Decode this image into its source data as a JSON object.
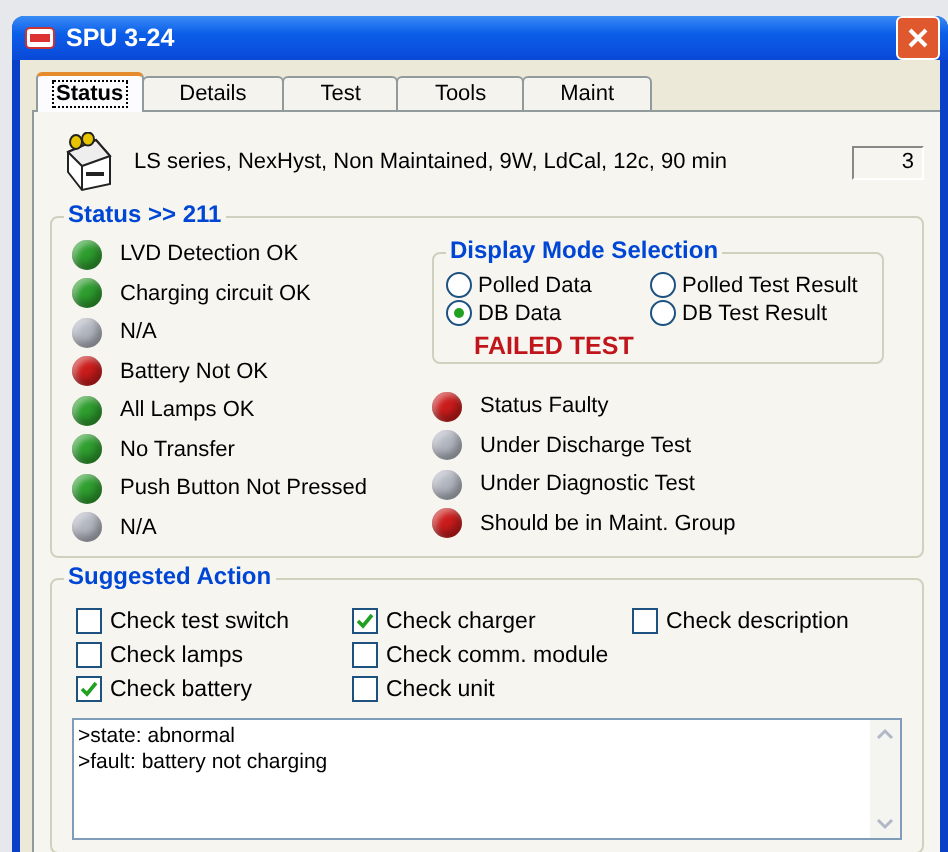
{
  "window": {
    "title": "SPU 3-24"
  },
  "tabs": [
    {
      "label": "Status",
      "selected": true
    },
    {
      "label": "Details",
      "selected": false
    },
    {
      "label": "Test",
      "selected": false
    },
    {
      "label": "Tools",
      "selected": false
    },
    {
      "label": "Maint",
      "selected": false
    }
  ],
  "device": {
    "description": "LS series, NexHyst, Non Maintained, 9W, LdCal, 12c, 90 min",
    "count": "3"
  },
  "status_group": {
    "title": "Status >> 211",
    "indicators_left": [
      {
        "label": "LVD Detection OK",
        "color": "#2e9e2e"
      },
      {
        "label": "Charging circuit OK",
        "color": "#2e9e2e"
      },
      {
        "label": "N/A",
        "color": "#b4b8c2"
      },
      {
        "label": "Battery Not OK",
        "color": "#cc1c1c"
      },
      {
        "label": "All Lamps OK",
        "color": "#2e9e2e"
      },
      {
        "label": "No Transfer",
        "color": "#2e9e2e"
      },
      {
        "label": "Push Button Not Pressed",
        "color": "#2e9e2e"
      },
      {
        "label": "N/A",
        "color": "#b4b8c2"
      }
    ],
    "indicators_right": [
      {
        "label": "Status Faulty",
        "color": "#cc1c1c"
      },
      {
        "label": "Under Discharge Test",
        "color": "#b4b8c2"
      },
      {
        "label": "Under Diagnostic Test",
        "color": "#b4b8c2"
      },
      {
        "label": "Should be in Maint. Group",
        "color": "#cc1c1c"
      }
    ]
  },
  "display_mode": {
    "title": "Display Mode Selection",
    "options": [
      {
        "label": "Polled Data",
        "selected": false
      },
      {
        "label": "Polled Test Result",
        "selected": false
      },
      {
        "label": "DB Data",
        "selected": true
      },
      {
        "label": "DB Test Result",
        "selected": false
      }
    ],
    "result": "FAILED TEST"
  },
  "suggested_action": {
    "title": "Suggested Action",
    "checks": [
      {
        "label": "Check test switch",
        "checked": false
      },
      {
        "label": "Check lamps",
        "checked": false
      },
      {
        "label": "Check battery",
        "checked": true
      },
      {
        "label": "Check charger",
        "checked": true
      },
      {
        "label": "Check comm. module",
        "checked": false
      },
      {
        "label": "Check unit",
        "checked": false
      },
      {
        "label": "Check description",
        "checked": false
      }
    ],
    "log": [
      ">state: abnormal",
      ">fault: battery not charging"
    ]
  }
}
